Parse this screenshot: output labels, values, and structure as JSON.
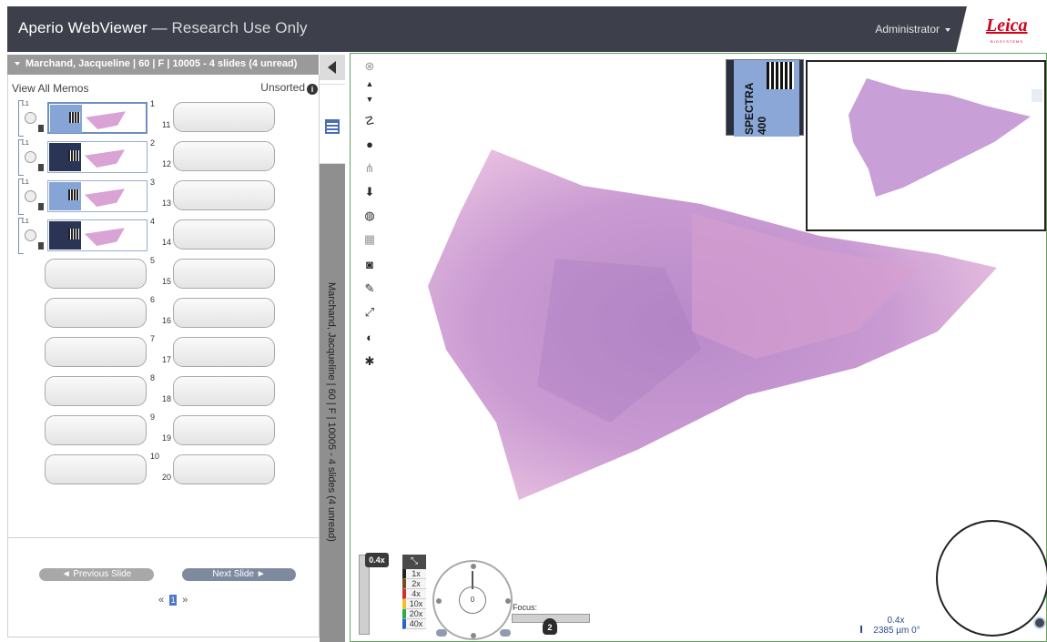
{
  "header": {
    "app_name": "Aperio WebViewer",
    "separator": " — ",
    "subtitle": "Research Use Only",
    "user_menu": "Administrator",
    "brand_logo": "Leica",
    "brand_sub": "BIOSYSTEMS"
  },
  "case": {
    "title": "Marchand, Jacqueline | 60 | F | 10005 - 4 slides (4 unread)",
    "vertical_title": "Marchand, Jacqueline | 60 | F | 10005 - 4 slides (4 unread)"
  },
  "panel": {
    "view_all_memos": "View All Memos",
    "sort_label": "Unsorted",
    "l1_label": "L1",
    "slots_left": [
      "1",
      "2",
      "3",
      "4",
      "5",
      "6",
      "7",
      "8",
      "9",
      "10"
    ],
    "slots_right": [
      "11",
      "12",
      "13",
      "14",
      "15",
      "16",
      "17",
      "18",
      "19",
      "20"
    ],
    "prev_button": "◄ Previous Slide",
    "next_button": "Next Slide ►",
    "pager": {
      "prev": "«",
      "current": "1",
      "next": "»"
    }
  },
  "viewer": {
    "label_text": "SPECTRA",
    "label_text2": "400",
    "zoom_chip": "0.4x",
    "magnifications": [
      {
        "label": "1x",
        "color": "#222222"
      },
      {
        "label": "2x",
        "color": "#7a4a1e"
      },
      {
        "label": "4x",
        "color": "#d62b2b"
      },
      {
        "label": "10x",
        "color": "#f2c21a"
      },
      {
        "label": "20x",
        "color": "#2fa84a"
      },
      {
        "label": "40x",
        "color": "#2a62c8"
      }
    ],
    "nav_center": "0",
    "focus_label": "Focus:",
    "focus_value": "2",
    "scale_zoom": "0.4x",
    "scale_distance": "2385 µm",
    "scale_rotation": "0°"
  },
  "colors": {
    "header_bg": "#3d3f4a",
    "viewer_border": "#62a362",
    "accent_blue": "#4c78c4",
    "tissue_pink": "#d9a3d6"
  }
}
